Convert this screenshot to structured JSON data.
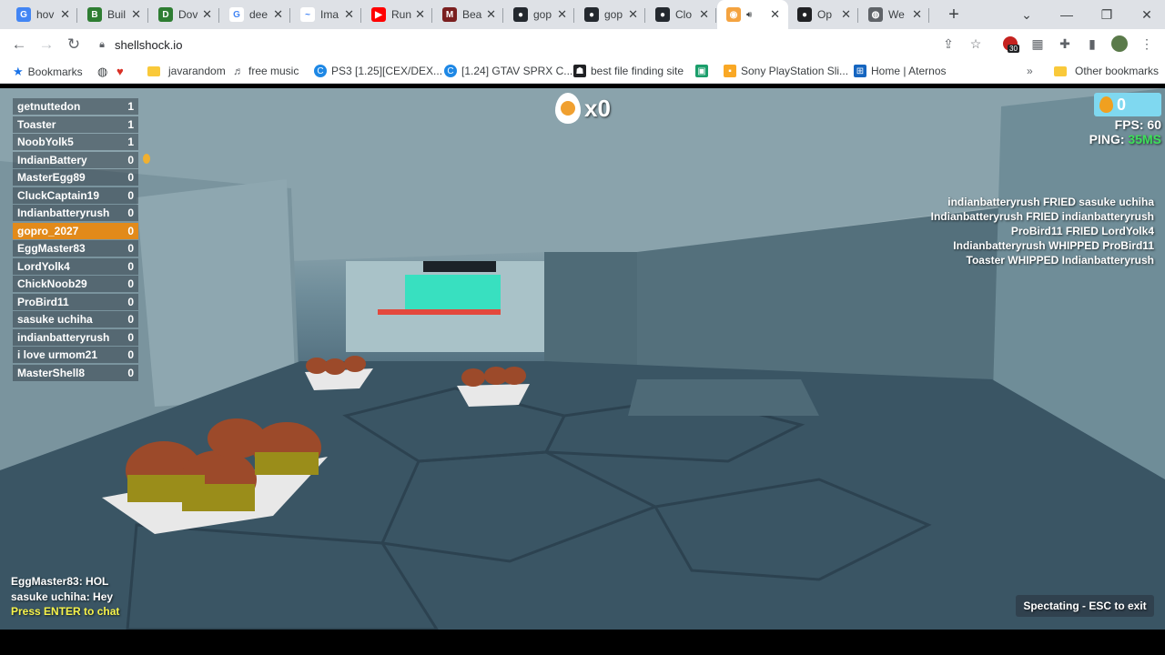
{
  "browser": {
    "tabs": [
      {
        "title": "hov",
        "fav_color": "#4285f4",
        "fav_glyph": "G"
      },
      {
        "title": "Buil",
        "fav_color": "#2e7d32",
        "fav_glyph": "B"
      },
      {
        "title": "Dov",
        "fav_color": "#2e7d32",
        "fav_glyph": "D"
      },
      {
        "title": "dee",
        "fav_color": "#ffffff",
        "fav_glyph": "G"
      },
      {
        "title": "Ima",
        "fav_color": "#ffffff",
        "fav_glyph": "~"
      },
      {
        "title": "Run",
        "fav_color": "#ff0000",
        "fav_glyph": "▶"
      },
      {
        "title": "Bea",
        "fav_color": "#7a1f1f",
        "fav_glyph": "M"
      },
      {
        "title": "gop",
        "fav_color": "#24292f",
        "fav_glyph": "●"
      },
      {
        "title": "gop",
        "fav_color": "#24292f",
        "fav_glyph": "●"
      },
      {
        "title": "Clo",
        "fav_color": "#24292f",
        "fav_glyph": "●"
      },
      {
        "title": "",
        "fav_color": "#f4a340",
        "fav_glyph": "◉",
        "active": true
      },
      {
        "title": "Op",
        "fav_color": "#202124",
        "fav_glyph": "●"
      },
      {
        "title": "We",
        "fav_color": "#5f6368",
        "fav_glyph": "◍"
      }
    ],
    "url": "shellshock.io",
    "extension_badge": "30",
    "bookmarks": [
      {
        "label": "Bookmarks",
        "icon": "star-icon"
      },
      {
        "label": "",
        "icon": "globe-icon"
      },
      {
        "label": "",
        "icon": "heart-icon"
      },
      {
        "label": "javarandom",
        "icon": "folder-icon"
      },
      {
        "label": "free music",
        "icon": "music-icon"
      },
      {
        "label": "PS3 [1.25][CEX/DEX...",
        "icon": "c-icon"
      },
      {
        "label": "[1.24] GTAV SPRX C...",
        "icon": "c-icon"
      },
      {
        "label": "best file finding site",
        "icon": "robot-icon"
      },
      {
        "label": "",
        "icon": "app-icon"
      },
      {
        "label": "Sony PlayStation Sli...",
        "icon": "bag-icon"
      },
      {
        "label": "Home | Aternos",
        "icon": "aternos-icon"
      },
      {
        "label": "Other bookmarks",
        "icon": "folder-icon"
      }
    ]
  },
  "game": {
    "scoreboard": [
      {
        "name": "getnuttedon",
        "score": "1"
      },
      {
        "name": "Toaster",
        "score": "1"
      },
      {
        "name": "NoobYolk5",
        "score": "1"
      },
      {
        "name": "IndianBattery",
        "score": "0"
      },
      {
        "name": "MasterEgg89",
        "score": "0"
      },
      {
        "name": "CluckCaptain19",
        "score": "0"
      },
      {
        "name": "Indianbatteryrush",
        "score": "0"
      },
      {
        "name": "gopro_2027",
        "score": "0",
        "me": true
      },
      {
        "name": "EggMaster83",
        "score": "0"
      },
      {
        "name": "LordYolk4",
        "score": "0"
      },
      {
        "name": "ChickNoob29",
        "score": "0"
      },
      {
        "name": "ProBird11",
        "score": "0"
      },
      {
        "name": "sasuke uchiha",
        "score": "0"
      },
      {
        "name": "indianbatteryrush",
        "score": "0"
      },
      {
        "name": "i love urmom21",
        "score": "0"
      },
      {
        "name": "MasterShell8",
        "score": "0"
      }
    ],
    "kill_count": "x0",
    "eggs": "0",
    "fps_label": "FPS: 60",
    "ping_label": "PING:",
    "ping_value": "35MS",
    "ping_color": "#3de05a",
    "kill_feed": [
      "indianbatteryrush FRIED sasuke uchiha",
      "Indianbatteryrush FRIED indianbatteryrush",
      "ProBird11 FRIED LordYolk4",
      "Indianbatteryrush WHIPPED ProBird11",
      "Toaster WHIPPED Indianbatteryrush"
    ],
    "chat": [
      "EggMaster83: HOL",
      "sasuke uchiha: Hey"
    ],
    "chat_prompt": "Press ENTER to chat",
    "spectate_label": "Spectating - ESC to exit"
  }
}
